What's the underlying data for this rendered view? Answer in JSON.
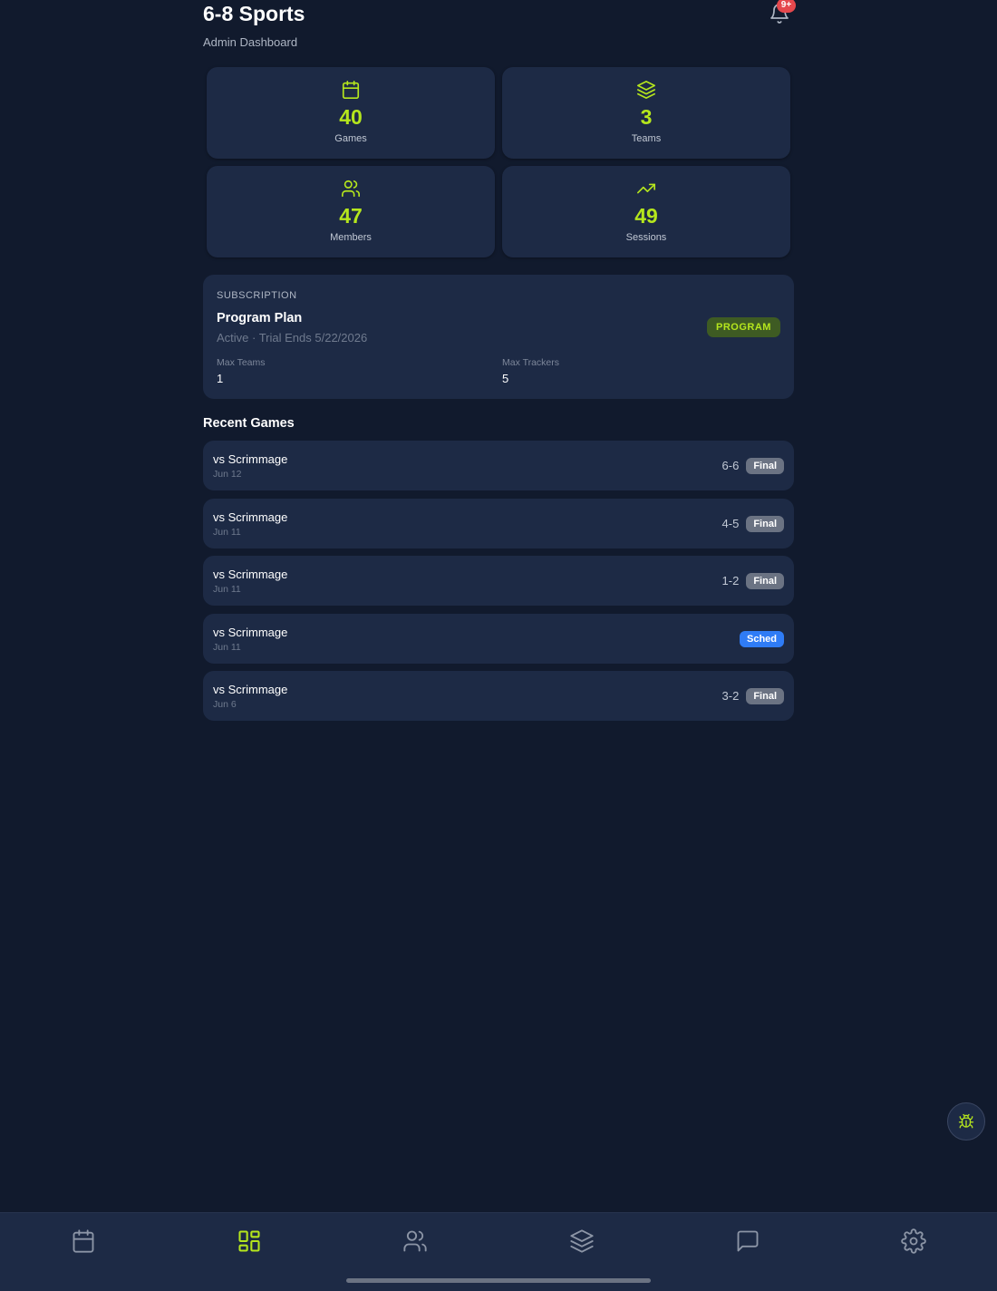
{
  "header": {
    "title": "6-8 Sports",
    "subtitle": "Admin Dashboard",
    "notification_badge": "9+"
  },
  "stats": [
    {
      "value": "40",
      "label": "Games",
      "icon": "calendar-icon"
    },
    {
      "value": "3",
      "label": "Teams",
      "icon": "layers-icon"
    },
    {
      "value": "47",
      "label": "Members",
      "icon": "users-icon"
    },
    {
      "value": "49",
      "label": "Sessions",
      "icon": "trending-up-icon"
    }
  ],
  "subscription": {
    "kicker": "SUBSCRIPTION",
    "plan_name": "Program Plan",
    "status": "Active · Trial Ends 5/22/2026",
    "badge": "PROGRAM",
    "limits": [
      {
        "label": "Max Teams",
        "value": "1"
      },
      {
        "label": "Max Trackers",
        "value": "5"
      }
    ]
  },
  "recent_games": {
    "title": "Recent Games",
    "items": [
      {
        "opponent": "vs Scrimmage",
        "date": "Jun 12",
        "score": "6-6",
        "status": "Final"
      },
      {
        "opponent": "vs Scrimmage",
        "date": "Jun 11",
        "score": "4-5",
        "status": "Final"
      },
      {
        "opponent": "vs Scrimmage",
        "date": "Jun 11",
        "score": "1-2",
        "status": "Final"
      },
      {
        "opponent": "vs Scrimmage",
        "date": "Jun 11",
        "score": "",
        "status": "Sched"
      },
      {
        "opponent": "vs Scrimmage",
        "date": "Jun 6",
        "score": "3-2",
        "status": "Final"
      }
    ]
  },
  "bottom_nav": [
    {
      "icon": "calendar-icon",
      "active": false
    },
    {
      "icon": "dashboard-grid-icon",
      "active": true
    },
    {
      "icon": "users-icon",
      "active": false
    },
    {
      "icon": "layers-icon",
      "active": false
    },
    {
      "icon": "chat-icon",
      "active": false
    },
    {
      "icon": "gear-icon",
      "active": false
    }
  ],
  "colors": {
    "background": "#111a2d",
    "card": "#1d2a45",
    "accent": "#b5e61d",
    "final_pill": "#6b7383",
    "sched_pill": "#2f7cf6",
    "notification": "#e5484d"
  }
}
